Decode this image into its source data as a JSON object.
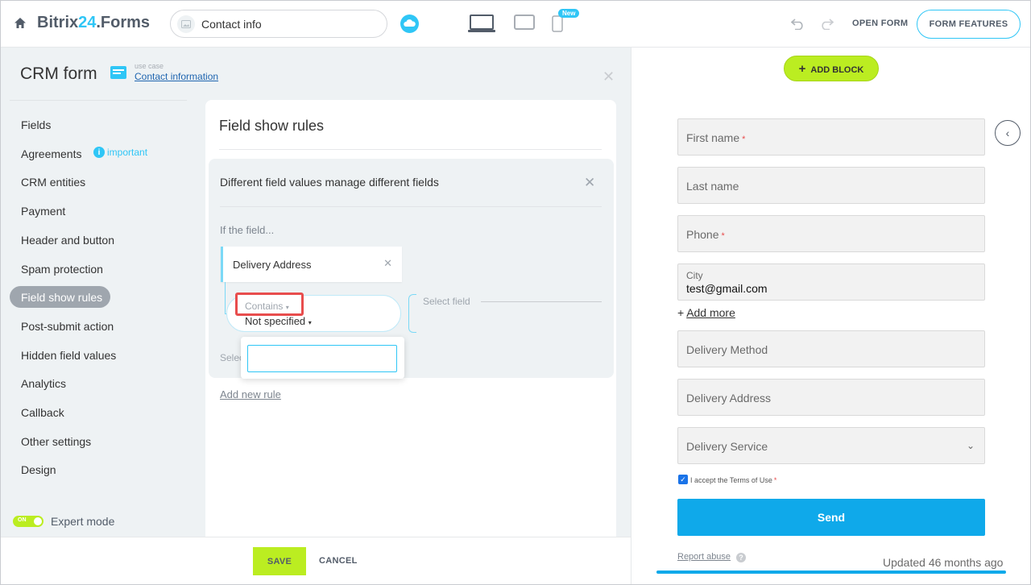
{
  "topbar": {
    "brand_main": "Bitrix",
    "brand_accent": "24",
    "brand_suffix": ".Forms",
    "form_name": "Contact info",
    "new_badge": "New",
    "open_form": "OPEN FORM",
    "form_features": "FORM FEATURES"
  },
  "sidebar": {
    "title": "CRM form",
    "usecase_small": "use case",
    "usecase_link": "Contact information",
    "items": [
      {
        "label": "Fields"
      },
      {
        "label": "Agreements"
      },
      {
        "label": "CRM entities"
      },
      {
        "label": "Payment"
      },
      {
        "label": "Header and button"
      },
      {
        "label": "Spam protection"
      },
      {
        "label": "Field show rules"
      },
      {
        "label": "Post-submit action"
      },
      {
        "label": "Hidden field values"
      },
      {
        "label": "Analytics"
      },
      {
        "label": "Callback"
      },
      {
        "label": "Other settings"
      },
      {
        "label": "Design"
      }
    ],
    "important_label": "important",
    "expert_toggle_on": "ON",
    "expert_label": "Expert mode"
  },
  "rules": {
    "title": "Field show rules",
    "rule_title": "Different field values manage different fields",
    "if_field": "If the field...",
    "field_chip": "Delivery Address",
    "operator": "Contains",
    "value": "Not specified",
    "select_field": "Select field",
    "select_peek": "Select field",
    "add_rule": "Add new rule"
  },
  "footer": {
    "save": "SAVE",
    "cancel": "CANCEL"
  },
  "preview": {
    "add_block": "ADD BLOCK",
    "fields": {
      "first_name": "First name",
      "last_name": "Last name",
      "phone": "Phone",
      "city_label": "City",
      "city_value": "test@gmail.com",
      "delivery_method": "Delivery Method",
      "delivery_address": "Delivery Address",
      "delivery_service": "Delivery Service"
    },
    "required_mark": "*",
    "add_more": "Add more",
    "terms": "I accept the Terms of Use",
    "send": "Send",
    "report_abuse": "Report abuse",
    "updated": "Updated 46 months ago"
  },
  "colors": {
    "accent": "#2fc6f6",
    "lime": "#bbed21",
    "send": "#0fa9ea",
    "required": "#e84d4d"
  }
}
